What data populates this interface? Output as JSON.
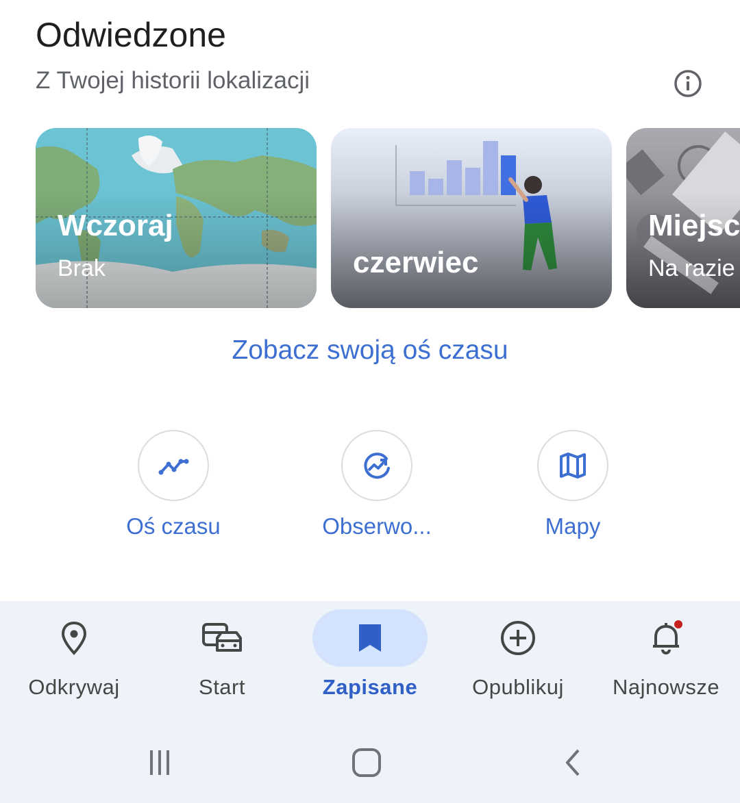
{
  "header": {
    "title": "Odwiedzone",
    "subtitle": "Z Twojej historii lokalizacji",
    "info_icon": "info-icon"
  },
  "cards": [
    {
      "title": "Wczoraj",
      "subtitle": "Brak",
      "image": "world-map"
    },
    {
      "title": "czerwiec",
      "subtitle": "",
      "image": "person-with-chart"
    },
    {
      "title": "Miejsc",
      "subtitle": "Na razie",
      "image": "abstract-objects"
    }
  ],
  "timeline_link": "Zobacz swoją oś czasu",
  "shortcuts": [
    {
      "label": "Oś czasu",
      "icon": "timeline-icon"
    },
    {
      "label": "Obserwo...",
      "icon": "trending-icon"
    },
    {
      "label": "Mapy",
      "icon": "map-icon"
    }
  ],
  "bottom_nav": [
    {
      "label": "Odkrywaj",
      "icon": "location-pin-icon"
    },
    {
      "label": "Start",
      "icon": "commute-icon"
    },
    {
      "label": "Zapisane",
      "icon": "bookmark-icon",
      "active": true
    },
    {
      "label": "Opublikuj",
      "icon": "add-circle-icon"
    },
    {
      "label": "Najnowsze",
      "icon": "bell-icon",
      "badge": true
    }
  ],
  "system_nav": [
    "recents-icon",
    "home-icon",
    "back-icon"
  ],
  "colors": {
    "accent": "#3c6fd1",
    "active_nav_bg": "#d3e2fd",
    "nav_bg": "#eef2f9",
    "badge": "#c5221f"
  }
}
